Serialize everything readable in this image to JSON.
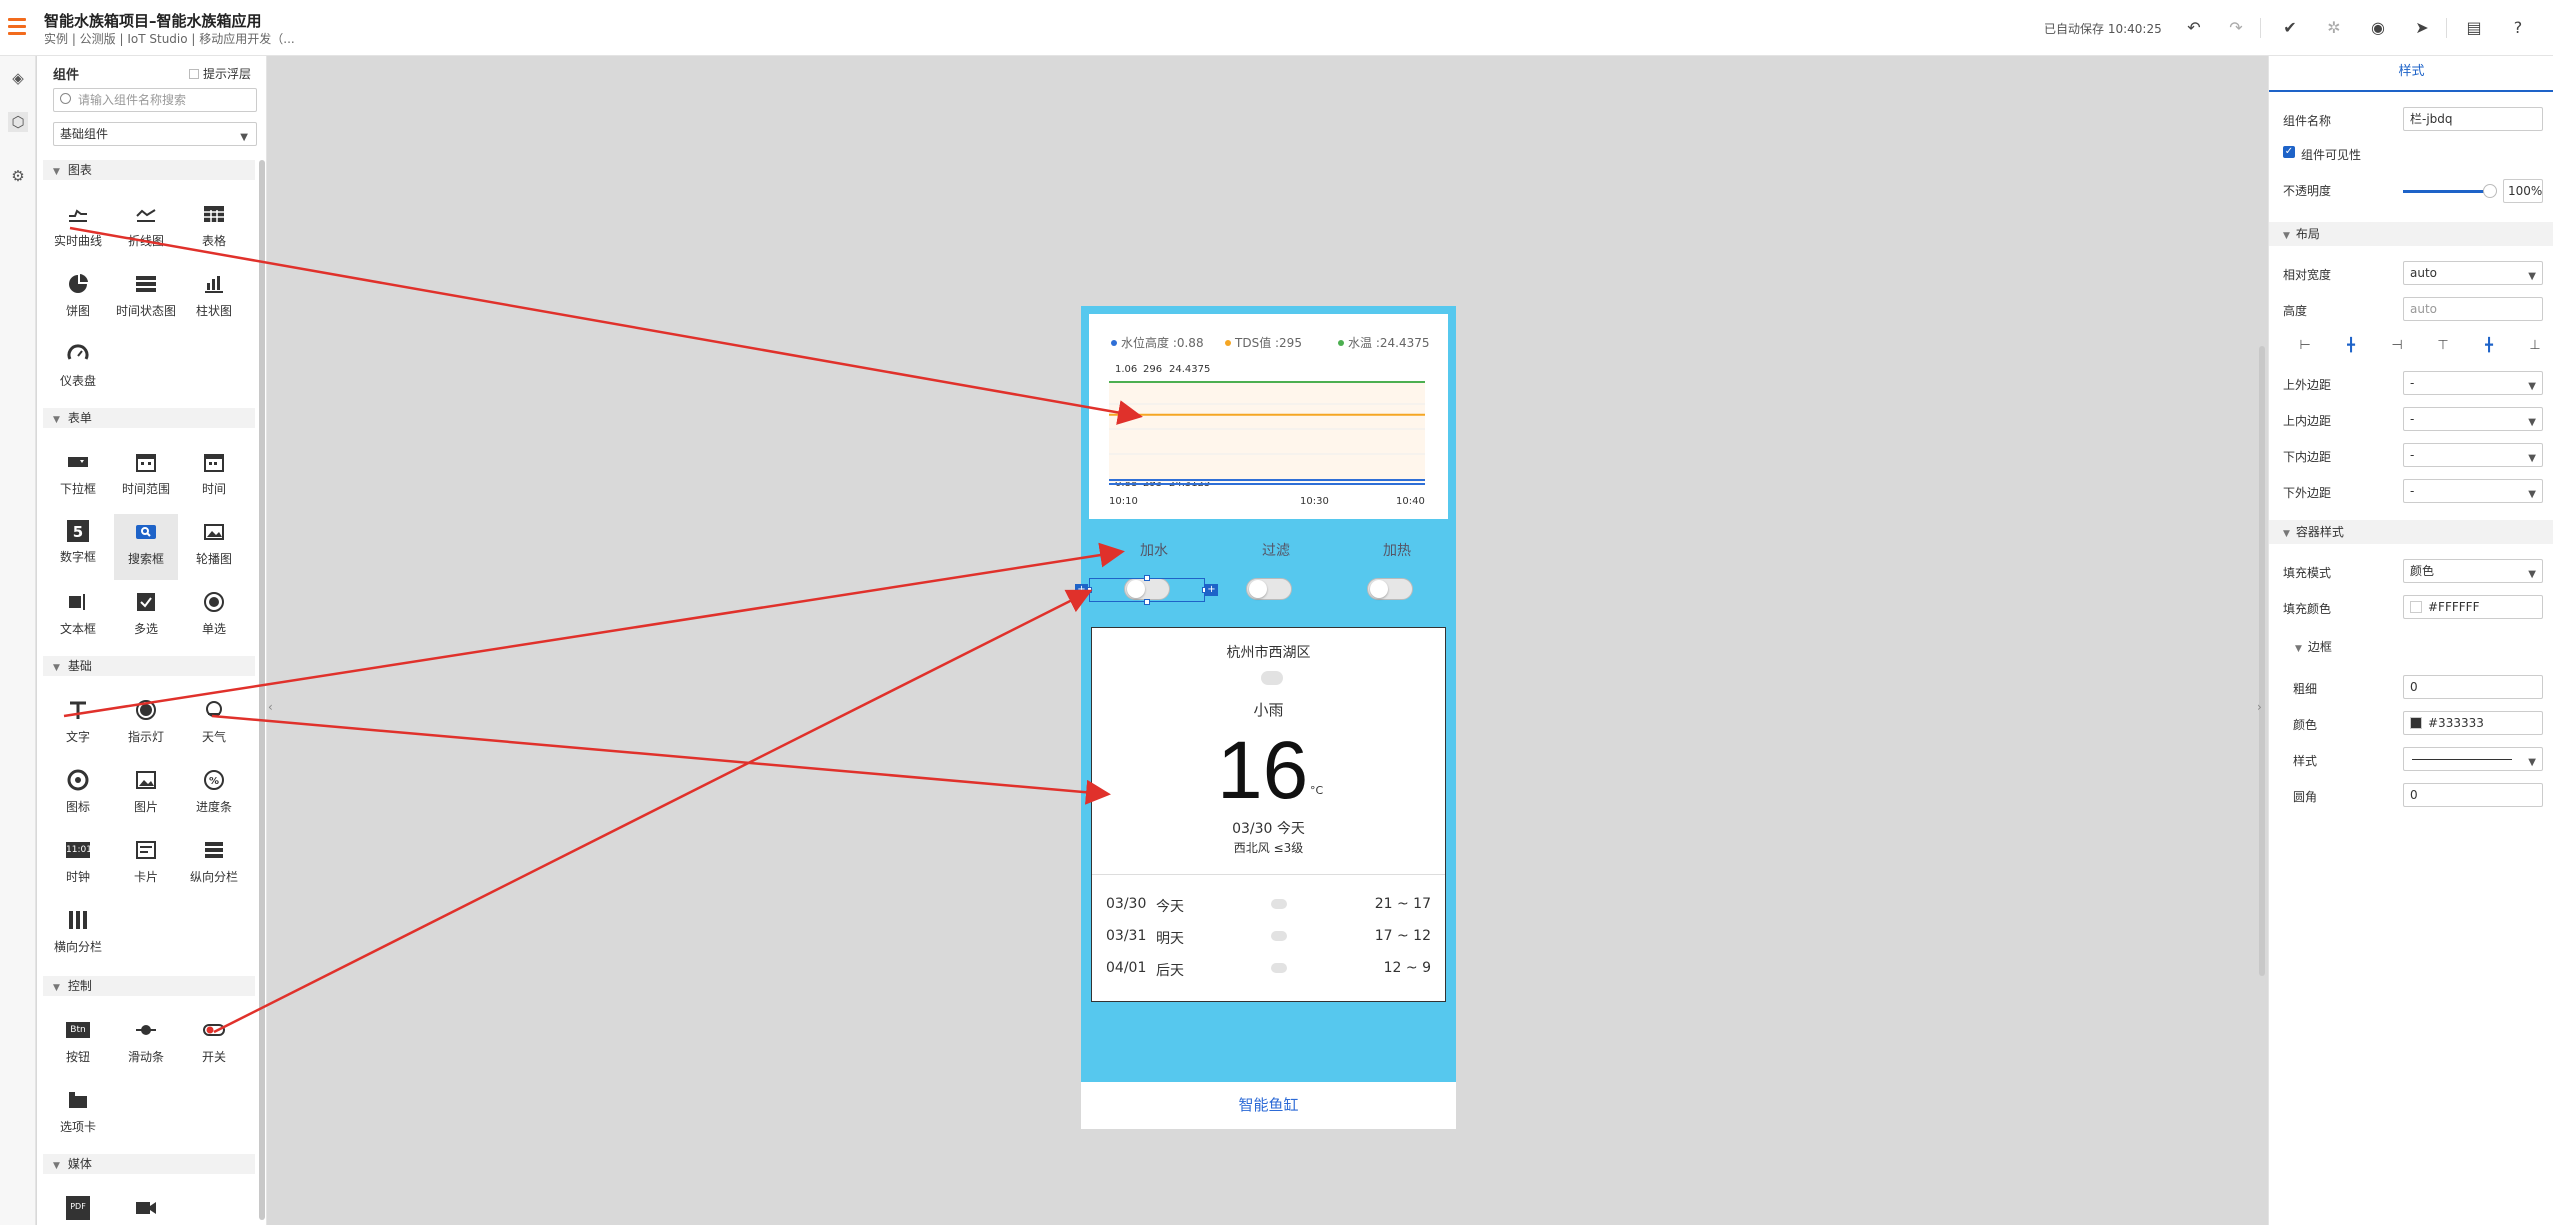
{
  "header": {
    "title": "智能水族箱项目–智能水族箱应用",
    "subtitle": "实例 | 公测版 | IoT Studio | 移动应用开发（...",
    "autosave": "已自动保存 10:40:25"
  },
  "left_panel": {
    "title": "组件",
    "hint_label": "提示浮层",
    "search_placeholder": "请输入组件名称搜索",
    "category_select": "基础组件",
    "sections": [
      {
        "name": "图表",
        "items": [
          "实时曲线",
          "折线图",
          "表格",
          "饼图",
          "时间状态图",
          "柱状图",
          "仪表盘"
        ]
      },
      {
        "name": "表单",
        "items": [
          "下拉框",
          "时间范围",
          "时间",
          "数字框",
          "搜索框",
          "轮播图",
          "文本框",
          "多选",
          "单选"
        ]
      },
      {
        "name": "基础",
        "items": [
          "文字",
          "指示灯",
          "天气",
          "图标",
          "图片",
          "进度条",
          "时钟",
          "卡片",
          "纵向分栏",
          "横向分栏"
        ]
      },
      {
        "name": "控制",
        "items": [
          "按钮",
          "滑动条",
          "开关",
          "选项卡"
        ]
      },
      {
        "name": "媒体",
        "items": []
      }
    ],
    "icon_texts": {
      "number": "5",
      "clock": "11:01",
      "btn": "Btn",
      "pdf": "PDF"
    }
  },
  "chart_data": {
    "type": "line",
    "legend": [
      "水位高度 :0.88",
      "TDS值 :295",
      "水温 :24.4375"
    ],
    "top_labels": [
      "1.06",
      "296",
      "24.4375"
    ],
    "bottom_labels": [
      "0.88",
      "293",
      "24.3125"
    ],
    "x_ticks": [
      "10:10",
      "10:30",
      "10:40"
    ],
    "series": [
      {
        "name": "水位高度",
        "color": "#2f6fd6",
        "values": [
          0.88,
          0.88,
          0.88,
          0.88
        ]
      },
      {
        "name": "TDS值",
        "color": "#f5a623",
        "values": [
          295,
          295,
          295,
          295
        ]
      },
      {
        "name": "水温",
        "color": "#4caf50",
        "values": [
          24.4375,
          24.4375,
          24.4375,
          24.4375
        ]
      }
    ]
  },
  "phone": {
    "controls": [
      "加水",
      "过滤",
      "加热"
    ],
    "weather": {
      "city": "杭州市西湖区",
      "condition": "小雨",
      "temp": "16",
      "unit": "°C",
      "date": "03/30 今天",
      "wind": "西北风  ≤3级",
      "forecast": [
        {
          "date": "03/30",
          "day": "今天",
          "range": "21 ~ 17"
        },
        {
          "date": "03/31",
          "day": "明天",
          "range": "17 ~ 12"
        },
        {
          "date": "04/01",
          "day": "后天",
          "range": "12 ~ 9"
        }
      ]
    },
    "footer": "智能鱼缸"
  },
  "right_panel": {
    "tab": "样式",
    "name_label": "组件名称",
    "name_value": "栏-jbdq",
    "visible_label": "组件可见性",
    "opacity_label": "不透明度",
    "opacity_value": "100%",
    "layout_section": "布局",
    "width_label": "相对宽度",
    "width_value": "auto",
    "height_label": "高度",
    "height_value": "auto",
    "margin_top_label": "上外边距",
    "padding_top_label": "上内边距",
    "padding_bottom_label": "下内边距",
    "margin_bottom_label": "下外边距",
    "dash": "-",
    "container_section": "容器样式",
    "fill_mode_label": "填充模式",
    "fill_mode_value": "颜色",
    "fill_color_label": "填充颜色",
    "fill_color_value": "#FFFFFF",
    "border_section": "边框",
    "thickness_label": "粗细",
    "thickness_value": "0",
    "color_label": "颜色",
    "color_value": "#333333",
    "style_label": "样式",
    "radius_label": "圆角",
    "radius_value": "0"
  },
  "colors": {
    "accent": "#1e63c8",
    "phone_bg": "#56c8ee",
    "arrow": "#e0312b",
    "menu": "#f26b1d"
  }
}
